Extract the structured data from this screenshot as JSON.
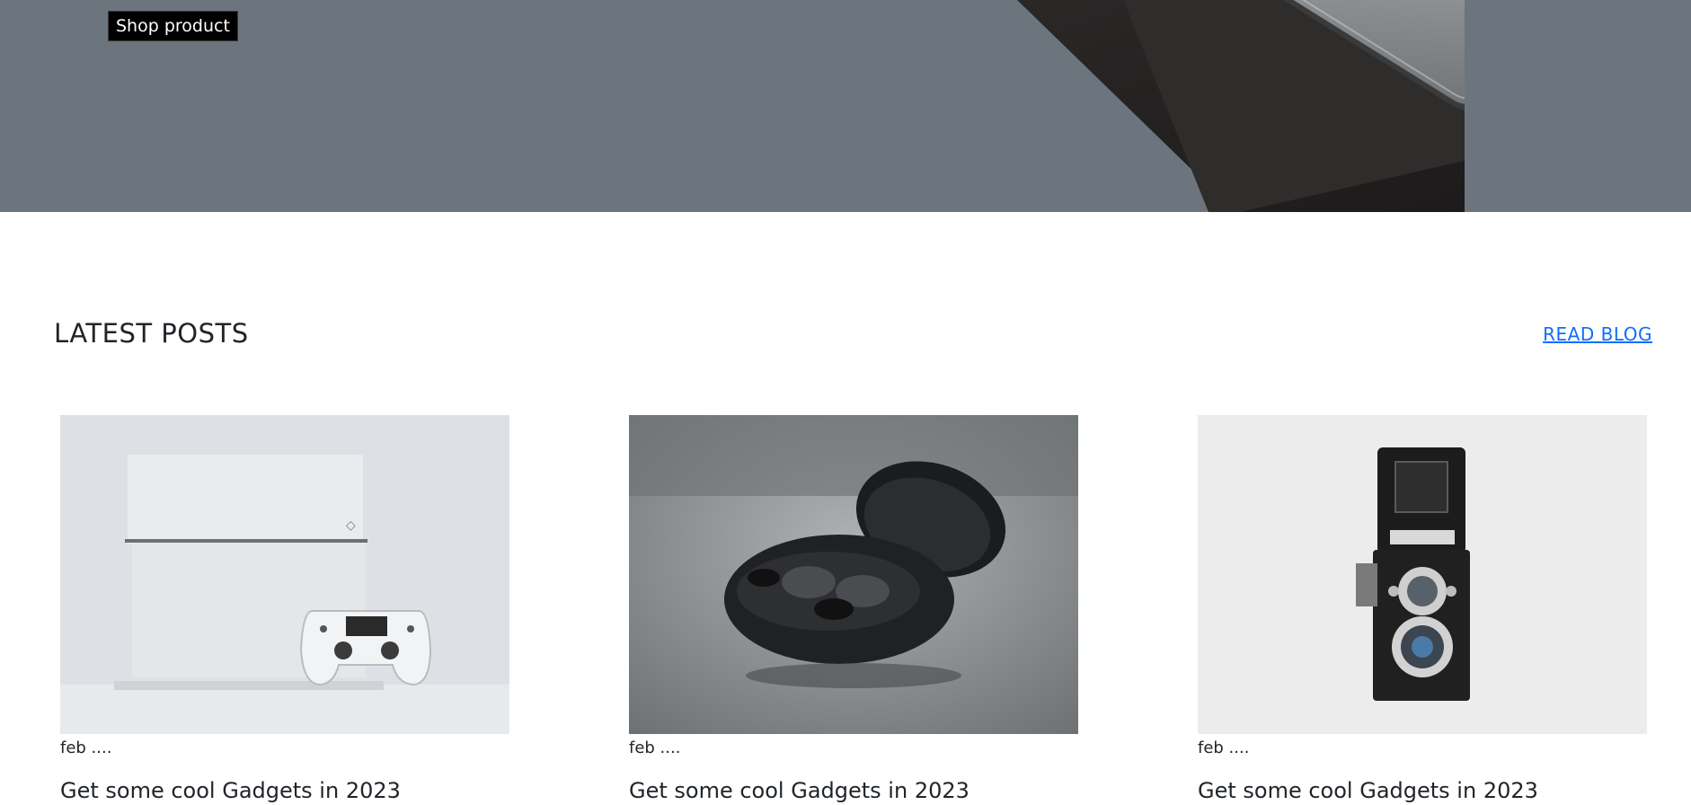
{
  "hero": {
    "button_label": "Shop product",
    "image": "phone-box-image",
    "background_color": "#6c757d"
  },
  "latest_posts": {
    "title": "LATEST POSTS",
    "read_blog_label": "READ BLOG",
    "link_color": "#0d6efd",
    "posts": [
      {
        "image": "console-controller-image",
        "date": "feb ....",
        "title": "Get some cool Gadgets in 2023"
      },
      {
        "image": "earbuds-case-image",
        "date": "feb ....",
        "title": "Get some cool Gadgets in 2023"
      },
      {
        "image": "vintage-camera-image",
        "date": "feb ....",
        "title": "Get some cool Gadgets in 2023"
      }
    ]
  }
}
